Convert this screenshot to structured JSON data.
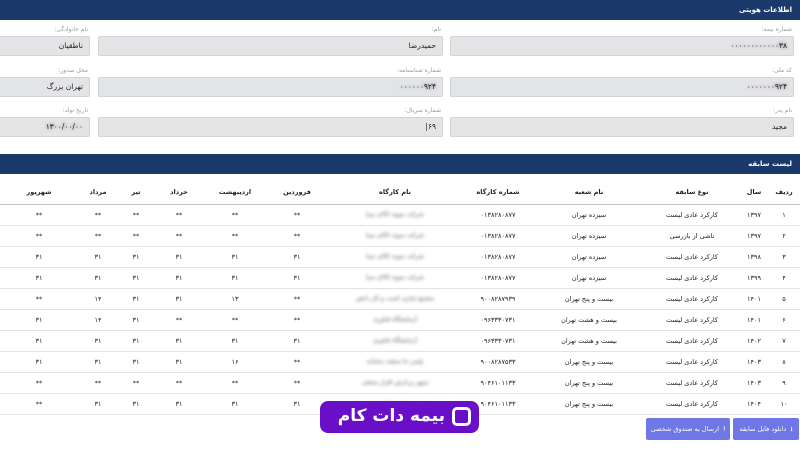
{
  "identity": {
    "title": "اطلاعات هویتی",
    "fields": {
      "insurance_no": {
        "label": "شماره بیمه:",
        "value": "۰۰۰۰۰۰۰۰۰۰۰۰۳۸"
      },
      "first_name": {
        "label": "نام:",
        "value": "حمیدرضا"
      },
      "last_name": {
        "label": "نام خانوادگی:",
        "value": "ناطقیان"
      },
      "national_code": {
        "label": "کد ملی:",
        "value": "۰۰۰۰۰۰۰۹۲۴"
      },
      "id_number": {
        "label": "شماره شناسنامه:",
        "value": "۰۰۰۰۰۰۹۲۴"
      },
      "issue_place": {
        "label": "محل صدور:",
        "value": "تهران بزرگ"
      },
      "father_name": {
        "label": "نام پدر:",
        "value": "مجید"
      },
      "serial_no": {
        "label": "شماره سریال:",
        "value": "۶۹|"
      },
      "birth_date": {
        "label": "تاریخ تولد:",
        "value": "۱۳۰۰/۰۰/۰۰"
      }
    }
  },
  "history": {
    "title": "لیست سابقه",
    "columns": [
      "ردیف",
      "سال",
      "نوع سابقه",
      "نام شعبه",
      "شماره کارگاه",
      "نام کارگاه",
      "فروردین",
      "اردیبهشت",
      "خرداد",
      "تیر",
      "مرداد",
      "شهریور"
    ],
    "rows": [
      [
        "۱",
        "۱۳۹۷",
        "کارکرد عادی لیست",
        "سیزده تهران",
        "۰۱۳۸۲۸۰۸۷۷",
        "شرکت نمونه کالای صبا",
        "**",
        "**",
        "**",
        "**",
        "**",
        "**"
      ],
      [
        "۲",
        "۱۳۹۷",
        "ناشی از بازرسی",
        "سیزده تهران",
        "۰۱۳۸۲۸۰۸۷۷",
        "شرکت نمونه کالای صبا",
        "**",
        "**",
        "**",
        "**",
        "**",
        "**"
      ],
      [
        "۳",
        "۱۳۹۸",
        "کارکرد عادی لیست",
        "سیزده تهران",
        "۰۱۳۸۲۸۰۸۷۷",
        "شرکت نمونه کالای صبا",
        "۳۱",
        "۳۱",
        "۳۱",
        "۳۱",
        "۳۱",
        "۳۱"
      ],
      [
        "۴",
        "۱۳۹۹",
        "کارکرد عادی لیست",
        "سیزده تهران",
        "۰۱۳۸۲۸۰۸۷۷",
        "شرکت نمونه کالای صبا",
        "۳۱",
        "۳۱",
        "۳۱",
        "۳۱",
        "۳۱",
        "۳۱"
      ],
      [
        "۵",
        "۱۴۰۱",
        "کارکرد عادی لیست",
        "بیست و پنج تهران",
        "۹۰۰۸۲۸۷۹۳۹",
        "مجتمع تجاری کسب و کار دانش",
        "**",
        "۱۳",
        "۳۱",
        "۳۱",
        "۱۴",
        "**"
      ],
      [
        "۶",
        "۱۴۰۱",
        "کارکرد عادی لیست",
        "بیست و هشت تهران",
        "۰۹۶۳۳۳۰۷۳۱",
        "آزمایشگاه فناوری",
        "**",
        "**",
        "**",
        "۳۱",
        "۱۴",
        "۳۱"
      ],
      [
        "۷",
        "۱۴۰۲",
        "کارکرد عادی لیست",
        "بیست و هشت تهران",
        "۰۹۶۳۳۳۰۷۳۱",
        "آزمایشگاه فناوری",
        "۳۱",
        "۳۱",
        "۳۱",
        "۳۱",
        "۳۱",
        "۳۱"
      ],
      [
        "۸",
        "۱۴۰۳",
        "کارکرد عادی لیست",
        "بیست و پنج تهران",
        "۹۰۰۸۲۸۷۵۳۳",
        "پلیمر دنا صنعت سامانه",
        "**",
        "۱۶",
        "۳۱",
        "۳۱",
        "۳۱",
        "۳۱"
      ],
      [
        "۹",
        "۱۴۰۳",
        "کارکرد عادی لیست",
        "بیست و پنج تهران",
        "۹۰۴۶۱۰۱۱۳۳",
        "سپهر پردازش افزار صنعتی",
        "**",
        "**",
        "**",
        "**",
        "**",
        "**"
      ],
      [
        "۱۰",
        "۱۴۰۴",
        "کارکرد عادی لیست",
        "بیست و پنج تهران",
        "۹۰۴۶۱۰۱۱۳۳",
        "سپهر پردازش افزار صنعتی",
        "۳۱",
        "۳۱",
        "۳۱",
        "۳۱",
        "۳۱",
        "**"
      ]
    ]
  },
  "actions": {
    "download_label": "دانلود فایل سابقه",
    "send_label": "ارسال به صندوق شخصی"
  },
  "watermark": {
    "text": "بیمه دات کام",
    "color": "#6a0fc8"
  },
  "colors": {
    "header": "#1b3a6b",
    "button": "#6f76e6"
  }
}
